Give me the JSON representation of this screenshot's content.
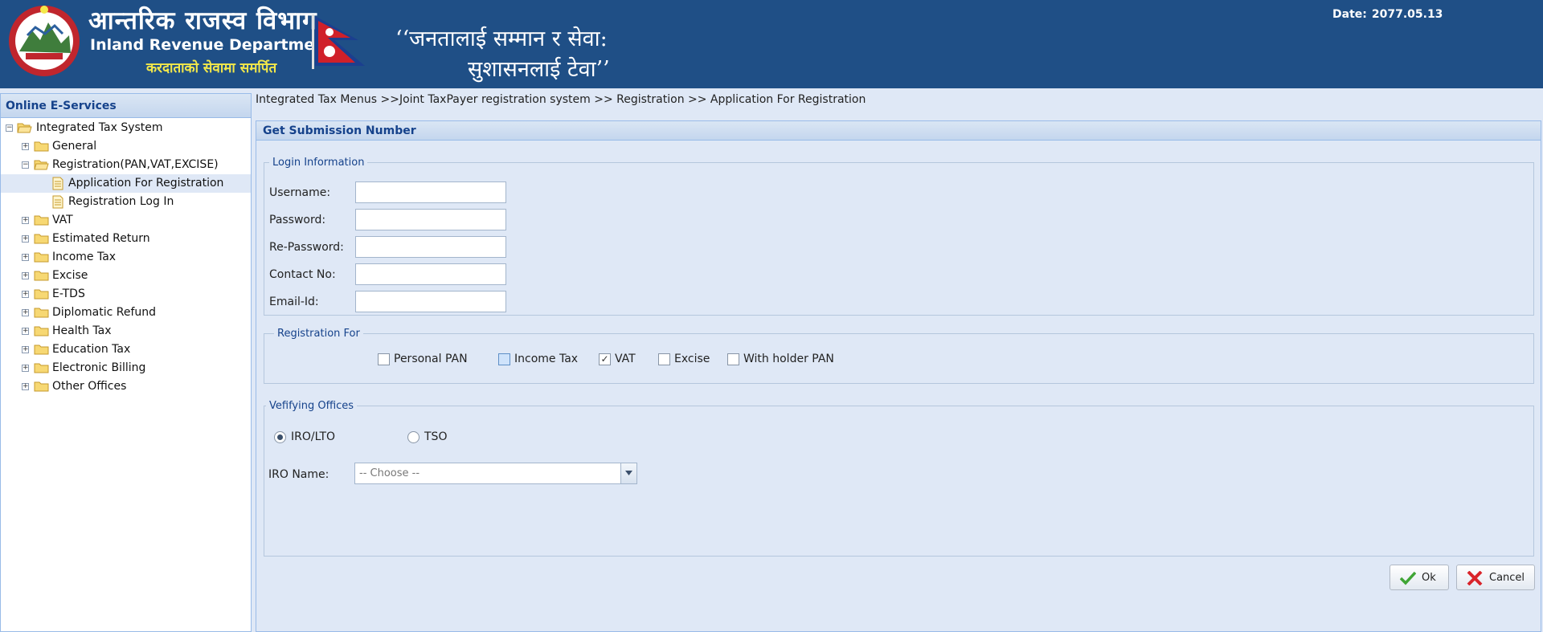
{
  "header": {
    "title_np": "आन्तरिक राजस्व विभाग",
    "title_en": "Inland Revenue Department",
    "tagline_np": "करदाताको सेवामा समर्पित",
    "slogan_line1": "‘‘जनतालाई सम्मान र सेवा:",
    "slogan_line2": "सुशासनलाई टेवा’’",
    "date_label": "Date:",
    "date_value": "2077.05.13"
  },
  "sidebar": {
    "title": "Online E-Services",
    "items": [
      {
        "label": "Integrated Tax System",
        "toggle": "−"
      },
      {
        "label": "General",
        "toggle": "+"
      },
      {
        "label": "Registration(PAN,VAT,EXCISE)",
        "toggle": "−"
      },
      {
        "label": "Application For Registration"
      },
      {
        "label": "Registration Log In"
      },
      {
        "label": "VAT",
        "toggle": "+"
      },
      {
        "label": "Estimated Return",
        "toggle": "+"
      },
      {
        "label": "Income Tax",
        "toggle": "+"
      },
      {
        "label": "Excise",
        "toggle": "+"
      },
      {
        "label": "E-TDS",
        "toggle": "+"
      },
      {
        "label": "Diplomatic Refund",
        "toggle": "+"
      },
      {
        "label": "Health Tax",
        "toggle": "+"
      },
      {
        "label": "Education Tax",
        "toggle": "+"
      },
      {
        "label": "Electronic Billing",
        "toggle": "+"
      },
      {
        "label": "Other Offices",
        "toggle": "+"
      }
    ]
  },
  "breadcrumb": "Integrated Tax Menus >>Joint TaxPayer registration system >> Registration >> Application For Registration",
  "panel": {
    "title": "Get Submission Number",
    "login": {
      "legend": "Login Information",
      "fields": [
        {
          "label": "Username:",
          "value": ""
        },
        {
          "label": "Password:",
          "value": ""
        },
        {
          "label": "Re-Password:",
          "value": ""
        },
        {
          "label": "Contact No:",
          "value": ""
        },
        {
          "label": "Email-Id:",
          "value": ""
        }
      ]
    },
    "registration": {
      "legend": "Registration For",
      "options": [
        {
          "label": "Personal PAN",
          "checked": false
        },
        {
          "label": "Income Tax",
          "checked": false
        },
        {
          "label": "VAT",
          "checked": true
        },
        {
          "label": "Excise",
          "checked": false
        },
        {
          "label": "With holder PAN",
          "checked": false
        }
      ],
      "check_mark": "✓"
    },
    "offices": {
      "legend": "Vefifying Offices",
      "radios": [
        {
          "label": "IRO/LTO",
          "selected": true
        },
        {
          "label": "TSO",
          "selected": false
        }
      ],
      "iro_label": "IRO Name:",
      "iro_selected": "-- Choose --"
    },
    "buttons": {
      "ok": "Ok",
      "cancel": "Cancel"
    }
  },
  "colors": {
    "header_bg": "#1f4f86",
    "panel_header_text": "#15428b",
    "tagline": "#f3e84a",
    "cancel_icon": "#d9242a",
    "ok_icon": "#3fa535"
  },
  "icons": [
    "government-emblem-icon",
    "nepal-flag-icon",
    "folder-icon",
    "document-icon",
    "expand-icon",
    "collapse-icon",
    "chevron-down-icon",
    "check-icon",
    "cross-icon"
  ]
}
